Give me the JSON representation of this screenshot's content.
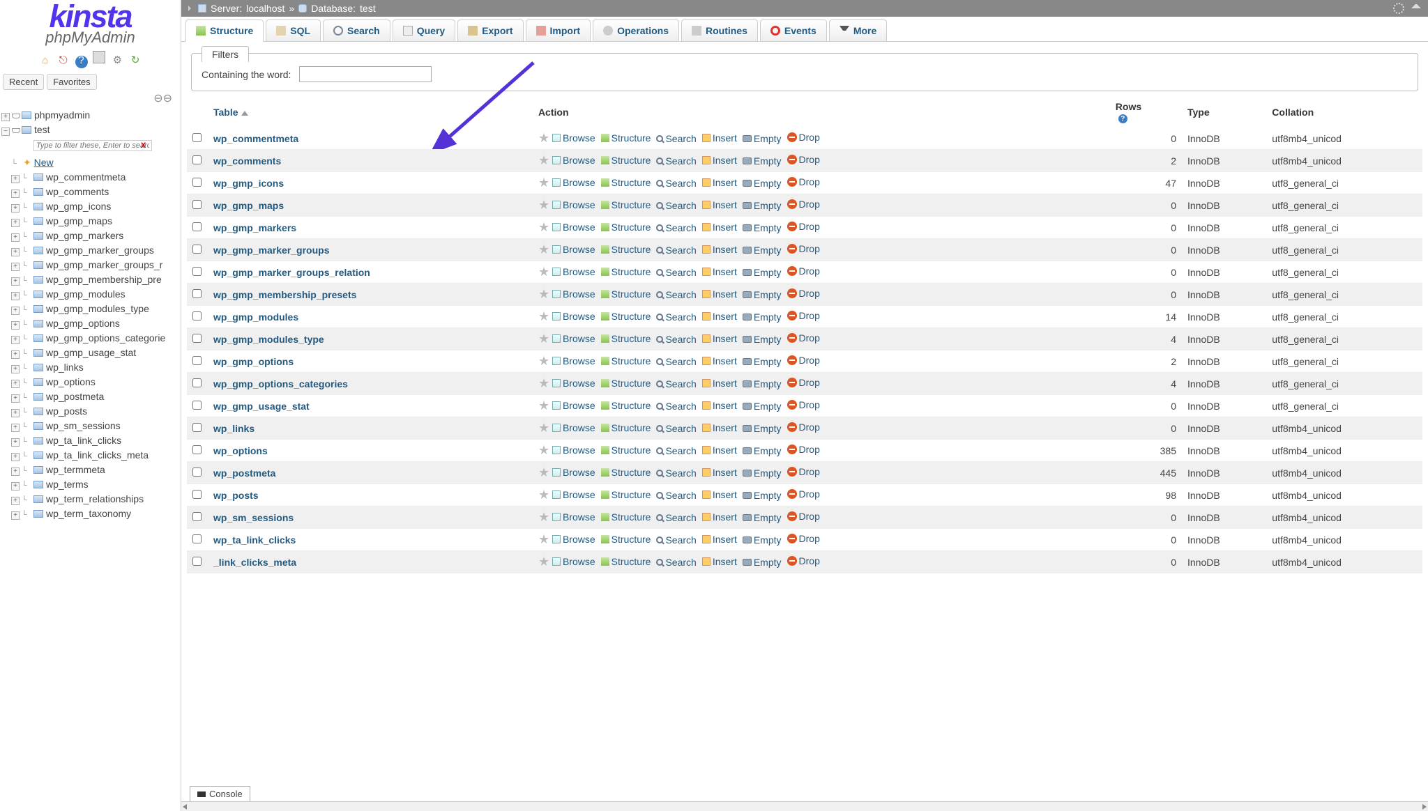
{
  "logo": {
    "brand": "kinsta",
    "product": "phpMyAdmin"
  },
  "side_tabs": {
    "recent": "Recent",
    "favorites": "Favorites"
  },
  "tree": {
    "root": "phpmyadmin",
    "db": "test",
    "filter_placeholder": "Type to filter these, Enter to search",
    "new": "New",
    "tables": [
      "wp_commentmeta",
      "wp_comments",
      "wp_gmp_icons",
      "wp_gmp_maps",
      "wp_gmp_markers",
      "wp_gmp_marker_groups",
      "wp_gmp_marker_groups_r",
      "wp_gmp_membership_pre",
      "wp_gmp_modules",
      "wp_gmp_modules_type",
      "wp_gmp_options",
      "wp_gmp_options_categorie",
      "wp_gmp_usage_stat",
      "wp_links",
      "wp_options",
      "wp_postmeta",
      "wp_posts",
      "wp_sm_sessions",
      "wp_ta_link_clicks",
      "wp_ta_link_clicks_meta",
      "wp_termmeta",
      "wp_terms",
      "wp_term_relationships",
      "wp_term_taxonomy"
    ]
  },
  "breadcrumb": {
    "server_label": "Server:",
    "server": "localhost",
    "sep": "»",
    "db_label": "Database:",
    "db": "test"
  },
  "tabs": [
    "Structure",
    "SQL",
    "Search",
    "Query",
    "Export",
    "Import",
    "Operations",
    "Routines",
    "Events",
    "More"
  ],
  "filters": {
    "title": "Filters",
    "label": "Containing the word:"
  },
  "columns": {
    "table": "Table",
    "action": "Action",
    "rows": "Rows",
    "type": "Type",
    "collation": "Collation"
  },
  "actions": {
    "browse": "Browse",
    "structure": "Structure",
    "search": "Search",
    "insert": "Insert",
    "empty": "Empty",
    "drop": "Drop"
  },
  "rows": [
    {
      "name": "wp_commentmeta",
      "rows": "0",
      "type": "InnoDB",
      "collation": "utf8mb4_unicod"
    },
    {
      "name": "wp_comments",
      "rows": "2",
      "type": "InnoDB",
      "collation": "utf8mb4_unicod"
    },
    {
      "name": "wp_gmp_icons",
      "rows": "47",
      "type": "InnoDB",
      "collation": "utf8_general_ci"
    },
    {
      "name": "wp_gmp_maps",
      "rows": "0",
      "type": "InnoDB",
      "collation": "utf8_general_ci"
    },
    {
      "name": "wp_gmp_markers",
      "rows": "0",
      "type": "InnoDB",
      "collation": "utf8_general_ci"
    },
    {
      "name": "wp_gmp_marker_groups",
      "rows": "0",
      "type": "InnoDB",
      "collation": "utf8_general_ci"
    },
    {
      "name": "wp_gmp_marker_groups_relation",
      "rows": "0",
      "type": "InnoDB",
      "collation": "utf8_general_ci"
    },
    {
      "name": "wp_gmp_membership_presets",
      "rows": "0",
      "type": "InnoDB",
      "collation": "utf8_general_ci"
    },
    {
      "name": "wp_gmp_modules",
      "rows": "14",
      "type": "InnoDB",
      "collation": "utf8_general_ci"
    },
    {
      "name": "wp_gmp_modules_type",
      "rows": "4",
      "type": "InnoDB",
      "collation": "utf8_general_ci"
    },
    {
      "name": "wp_gmp_options",
      "rows": "2",
      "type": "InnoDB",
      "collation": "utf8_general_ci"
    },
    {
      "name": "wp_gmp_options_categories",
      "rows": "4",
      "type": "InnoDB",
      "collation": "utf8_general_ci"
    },
    {
      "name": "wp_gmp_usage_stat",
      "rows": "0",
      "type": "InnoDB",
      "collation": "utf8_general_ci"
    },
    {
      "name": "wp_links",
      "rows": "0",
      "type": "InnoDB",
      "collation": "utf8mb4_unicod"
    },
    {
      "name": "wp_options",
      "rows": "385",
      "type": "InnoDB",
      "collation": "utf8mb4_unicod"
    },
    {
      "name": "wp_postmeta",
      "rows": "445",
      "type": "InnoDB",
      "collation": "utf8mb4_unicod"
    },
    {
      "name": "wp_posts",
      "rows": "98",
      "type": "InnoDB",
      "collation": "utf8mb4_unicod"
    },
    {
      "name": "wp_sm_sessions",
      "rows": "0",
      "type": "InnoDB",
      "collation": "utf8mb4_unicod"
    },
    {
      "name": "wp_ta_link_clicks",
      "rows": "0",
      "type": "InnoDB",
      "collation": "utf8mb4_unicod"
    },
    {
      "name": "_link_clicks_meta",
      "rows": "0",
      "type": "InnoDB",
      "collation": "utf8mb4_unicod"
    }
  ],
  "console": "Console"
}
